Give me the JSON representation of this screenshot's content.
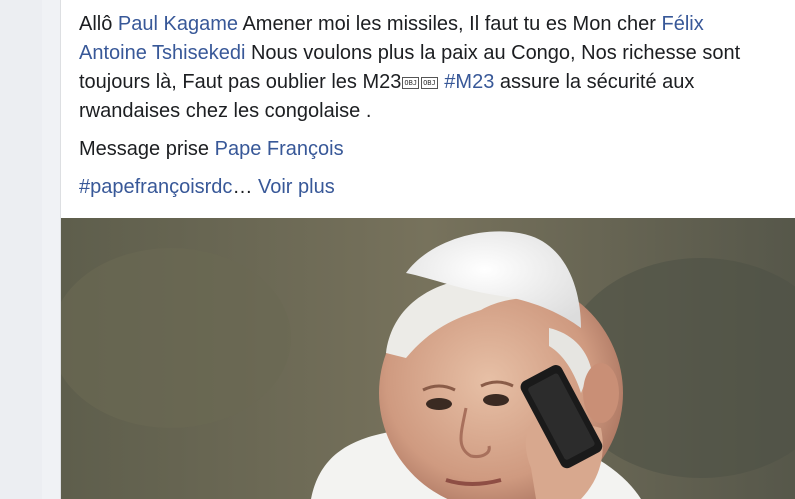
{
  "post": {
    "paragraph1": {
      "t1": "Allô ",
      "link_kagame": "Paul Kagame",
      "t2": " Amener moi les missiles, Il faut tu es Mon cher ",
      "link_tshisekedi": "Félix Antoine Tshisekedi",
      "t3": " Nous voulons plus la paix au Congo, Nos richesse sont toujours là, Faut pas oublier les M23",
      "obj1": "OBJ",
      "obj2": "OBJ",
      "hashtag_m23": "#M23",
      "t4": " assure la sécurité aux rwandaises chez les congolaise ."
    },
    "paragraph2": {
      "t1": "Message prise ",
      "link_pape": "Pape François"
    },
    "paragraph3": {
      "hashtag": "#papefrançoisrdc",
      "ellipsis": "… ",
      "see_more": "Voir plus"
    }
  },
  "colors": {
    "link": "#385898",
    "text": "#1c1e21",
    "background": "#f0f2f5"
  }
}
